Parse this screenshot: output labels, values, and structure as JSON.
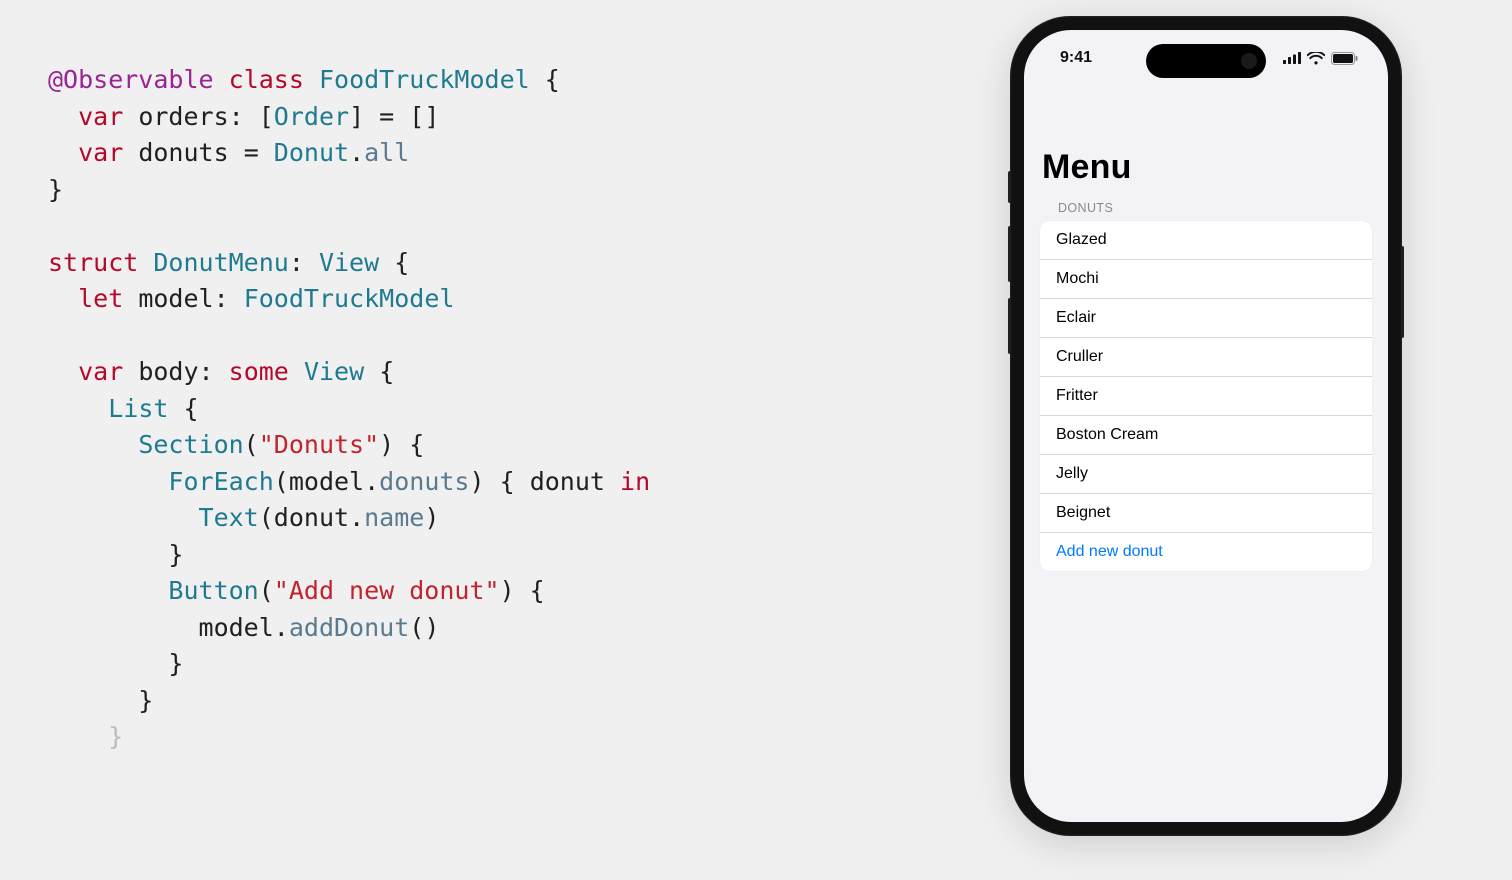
{
  "code": {
    "tokens": {
      "observable": "@Observable",
      "class_kw": "class",
      "model_type": "FoodTruckModel",
      "var_kw": "var",
      "orders_id": "orders",
      "order_type": "Order",
      "empty_arr": "[]",
      "donuts_id": "donuts",
      "donut_type": "Donut",
      "all_member": "all",
      "struct_kw": "struct",
      "donutmenu_type": "DonutMenu",
      "view_type": "View",
      "let_kw": "let",
      "model_id": "model",
      "body_id": "body",
      "some_kw": "some",
      "list_type": "List",
      "section_type": "Section",
      "donuts_str": "\"Donuts\"",
      "foreach_type": "ForEach",
      "donuts_member": "donuts",
      "donut_param": "donut",
      "in_kw": "in",
      "text_type": "Text",
      "name_member": "name",
      "button_type": "Button",
      "addnew_str": "\"Add new donut\"",
      "adddonut_member": "addDonut"
    }
  },
  "phone": {
    "status": {
      "time": "9:41"
    },
    "title": "Menu",
    "section_header": "DONUTS",
    "rows": {
      "r0": "Glazed",
      "r1": "Mochi",
      "r2": "Eclair",
      "r3": "Cruller",
      "r4": "Fritter",
      "r5": "Boston Cream",
      "r6": "Jelly",
      "r7": "Beignet"
    },
    "add_row": "Add new donut"
  }
}
